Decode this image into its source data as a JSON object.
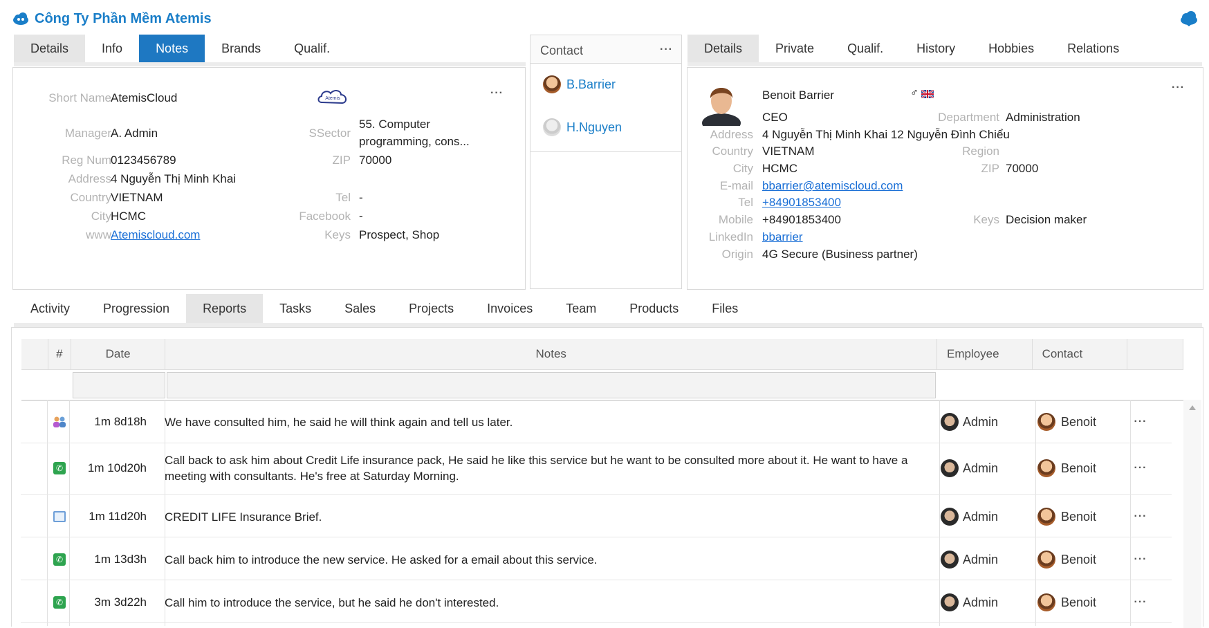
{
  "company": {
    "title": "Công Ty Phần Mềm Atemis",
    "left_tabs": [
      "Details",
      "Info",
      "Notes",
      "Brands",
      "Qualif."
    ],
    "active_tab": "Notes",
    "logo_text": "Atemis",
    "fields": {
      "short_name_label": "Short Name",
      "short_name": "AtemisCloud",
      "manager_label": "Manager",
      "manager": "A. Admin",
      "ssector_label": "SSector",
      "ssector_line1": "55. Computer",
      "ssector_line2": "programming, cons...",
      "regnum_label": "Reg Num",
      "regnum": "0123456789",
      "zip_label": "ZIP",
      "zip": "70000",
      "address_label": "Address",
      "address": "4 Nguyễn Thị Minh Khai",
      "country_label": "Country",
      "country": "VIETNAM",
      "tel_label": "Tel",
      "tel": "-",
      "city_label": "City",
      "city": "HCMC",
      "facebook_label": "Facebook",
      "facebook": "-",
      "www_label": "www",
      "www": "Atemiscloud.com",
      "keys_label": "Keys",
      "keys": "Prospect, Shop"
    }
  },
  "contacts_panel": {
    "header": "Contact",
    "items": [
      "B.Barrier",
      "H.Nguyen"
    ]
  },
  "person": {
    "tabs": [
      "Details",
      "Private",
      "Qualif.",
      "History",
      "Hobbies",
      "Relations"
    ],
    "active_tab": "Details",
    "name": "Benoit Barrier",
    "gender_symbol": "♂",
    "title": "CEO",
    "department_label": "Department",
    "department": "Administration",
    "address_label": "Address",
    "address": "4 Nguyễn Thị Minh Khai 12 Nguyễn Đình Chiểu",
    "country_label": "Country",
    "country": "VIETNAM",
    "region_label": "Region",
    "city_label": "City",
    "city": "HCMC",
    "zip_label": "ZIP",
    "zip": "70000",
    "email_label": "E-mail",
    "email": "bbarrier@atemiscloud.com",
    "tel_label": "Tel",
    "tel": "+84901853400",
    "mobile_label": "Mobile",
    "mobile": "+84901853400",
    "keys_label": "Keys",
    "keys": "Decision maker",
    "linkedin_label": "LinkedIn",
    "linkedin": "bbarrier",
    "origin_label": "Origin",
    "origin": "4G Secure (Business partner)"
  },
  "bottom_tabs": [
    "Activity",
    "Progression",
    "Reports",
    "Tasks",
    "Sales",
    "Projects",
    "Invoices",
    "Team",
    "Products",
    "Files"
  ],
  "bottom_active_tab": "Reports",
  "grid": {
    "headers": {
      "num": "#",
      "date": "Date",
      "notes": "Notes",
      "employee": "Employee",
      "contact": "Contact"
    },
    "rows": [
      {
        "icon": "meeting-icon",
        "date": "1m 8d18h",
        "notes": "We have consulted him, he said he will think again and tell us later.",
        "employee": "Admin",
        "contact": "Benoit"
      },
      {
        "icon": "phone-icon",
        "date": "1m 10d20h",
        "notes": "Call back to ask him about Credit Life insurance pack, He said he like this service but he want to be consulted more about it. He want to have a meeting with consultants. He's free at Saturday Morning.",
        "employee": "Admin",
        "contact": "Benoit"
      },
      {
        "icon": "mail-icon",
        "date": "1m 11d20h",
        "notes": "CREDIT LIFE Insurance Brief.",
        "employee": "Admin",
        "contact": "Benoit"
      },
      {
        "icon": "phone-icon",
        "date": "1m 13d3h",
        "notes": "Call back him to introduce the new service. He asked for a email about this service.",
        "employee": "Admin",
        "contact": "Benoit"
      },
      {
        "icon": "phone-icon",
        "date": "3m 3d22h",
        "notes": "Call him to introduce the service, but he said he don't interested.",
        "employee": "Admin",
        "contact": "Benoit"
      }
    ],
    "more_label": "···"
  },
  "colors": {
    "accent": "#1e78c2",
    "link": "#1a6fd6",
    "label": "#b3b3b3"
  }
}
